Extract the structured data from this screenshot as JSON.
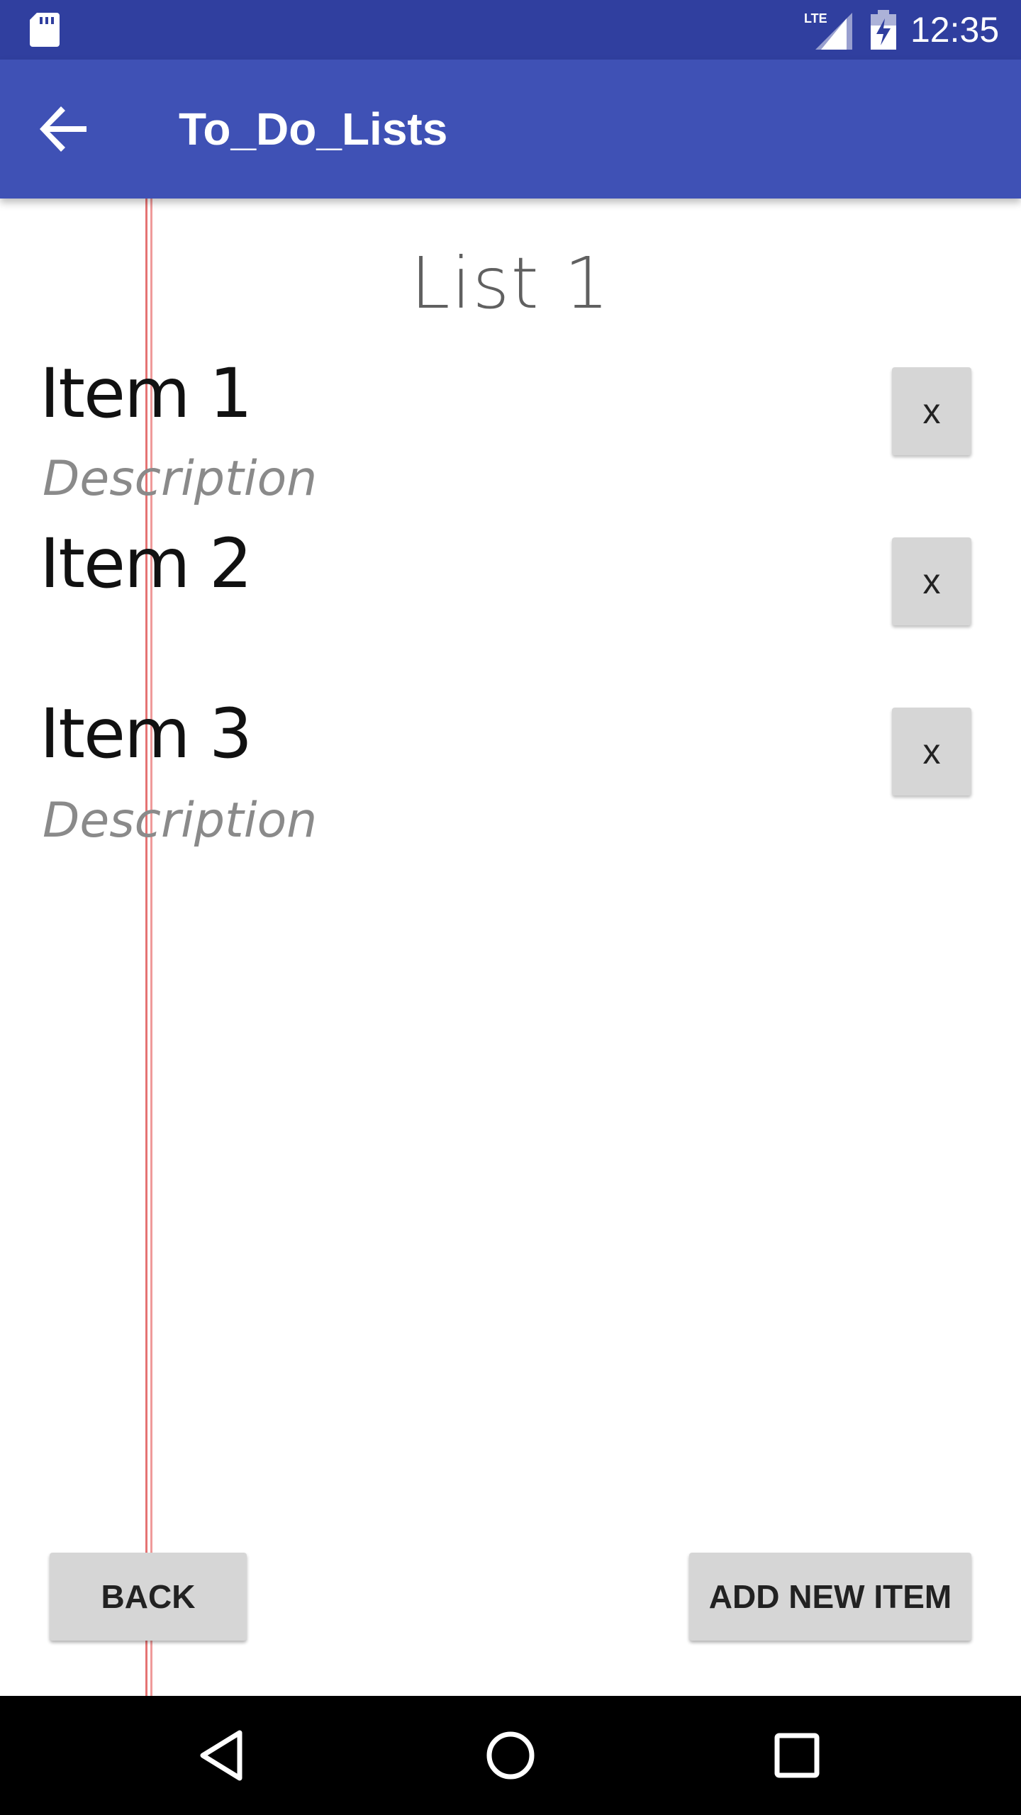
{
  "status_bar": {
    "time": "12:35",
    "network_label": "LTE",
    "icons": [
      "sd-card-icon",
      "lte-signal-icon",
      "battery-charging-icon"
    ]
  },
  "app_bar": {
    "title": "To_Do_Lists",
    "back_icon": "arrow-back-icon"
  },
  "list": {
    "title": "List 1",
    "items": [
      {
        "title": "Item 1",
        "description": "Description",
        "delete_label": "x"
      },
      {
        "title": "Item 2",
        "description": "",
        "delete_label": "x"
      },
      {
        "title": "Item 3",
        "description": "Description",
        "delete_label": "x"
      }
    ]
  },
  "buttons": {
    "back_label": "BACK",
    "add_label": "ADD NEW ITEM"
  },
  "nav_bar": {
    "icons": [
      "nav-back-icon",
      "nav-home-icon",
      "nav-recents-icon"
    ]
  },
  "colors": {
    "status_bar": "#303f9f",
    "app_bar": "#3f51b5",
    "paper_line": "#8fa8d8",
    "margin_line": "#e57373",
    "button_bg": "#d6d6d6"
  }
}
